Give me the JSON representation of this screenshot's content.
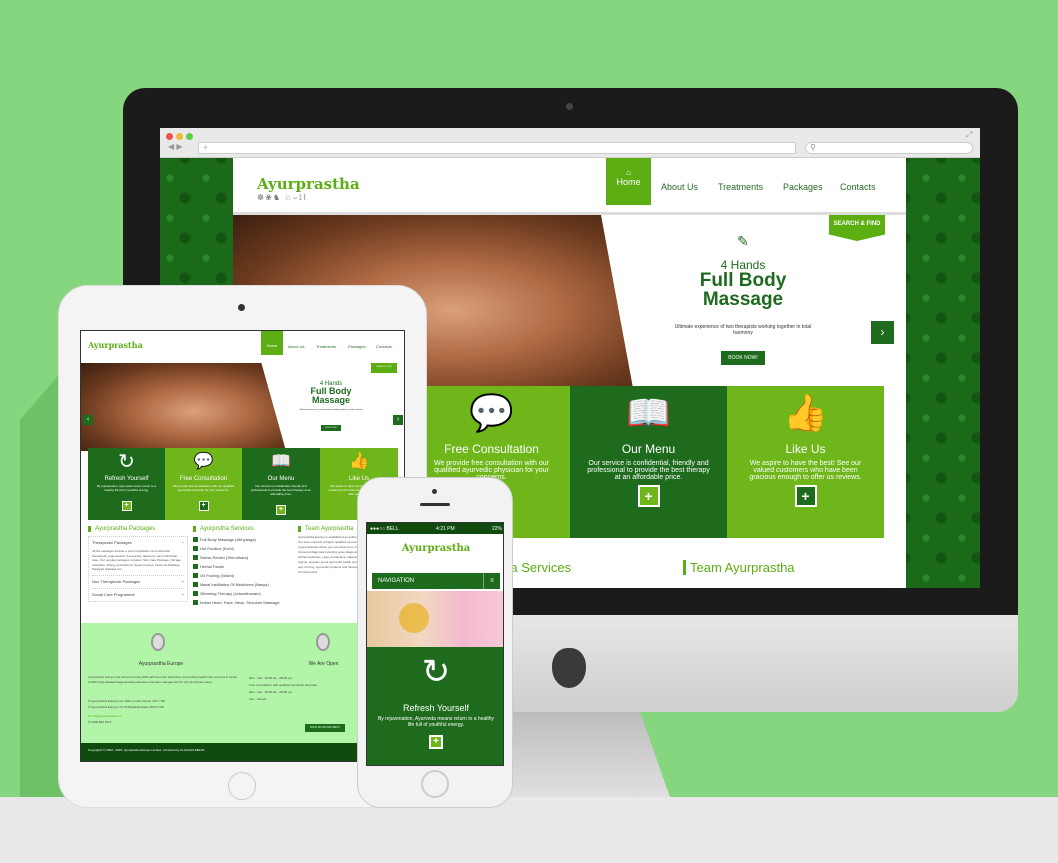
{
  "desktop": {
    "search_placeholder": "",
    "logo": "Ayurprastha",
    "logo_symbols": "☸❀♞ ♘⌣⟟⌇",
    "nav": [
      {
        "label": "Home",
        "icon": "home-icon"
      },
      {
        "label": "About Us"
      },
      {
        "label": "Treatments"
      },
      {
        "label": "Packages"
      },
      {
        "label": "Contacts"
      }
    ],
    "search_find": "SEARCH & FIND",
    "hero": {
      "subtitle": "4 Hands",
      "title1": "Full Body",
      "title2": "Massage",
      "desc": "Ultimate experience of two therapists working together in total harmony",
      "cta": "BOOK NOW!"
    },
    "features": [
      {
        "title": "Free Consultation",
        "text": "We provide free consultation with our qualified ayurvedic physician for your concerns.",
        "icon": "chat-bubbles-icon"
      },
      {
        "title": "Our Menu",
        "text": "Our service is confidential, friendly and professional to provide the best therapy at an affordable price.",
        "icon": "book-icon"
      },
      {
        "title": "Like Us",
        "text": "We aspire to have the best! See our valued customers who have been gracious enough to offer us reviews.",
        "icon": "thumbs-up-icon"
      }
    ],
    "headings": [
      "Ayurprstha Services",
      "Team Ayurprastha"
    ]
  },
  "tablet": {
    "logo": "Ayurprastha",
    "nav": [
      "Home",
      "About Us",
      "Treatments",
      "Packages",
      "Contacts"
    ],
    "search_find": "SEARCH & FIND",
    "hero": {
      "subtitle": "4 Hands",
      "title1": "Full Body",
      "title2": "Massage",
      "desc": "Ultimate experience of two therapists working together in total harmony",
      "cta": "BOOK NOW!"
    },
    "features": [
      {
        "title": "Refresh Yourself",
        "text": "By rejuvenation, Ayurveda means return to a healthy life full of youthful energy."
      },
      {
        "title": "Free Consultation",
        "text": "We provide free consultation with our qualified ayurvedic physician for your concerns."
      },
      {
        "title": "Our Menu",
        "text": "Our service is confidential, friendly and professional to provide the best therapy at an affordable price."
      },
      {
        "title": "Like Us",
        "text": "We aspire to have the best! See our valued customers who have been gracious enough to offer us reviews."
      }
    ],
    "packages": {
      "heading": "Ayurprastha Packages",
      "items": [
        {
          "label": "Therapeutic Packages",
          "toggle": "−",
          "text": "All the packages include a prior consultation and individual therapeutic yoga session if necessary tailored to each individual case. Our popular packages includes: Skin Care Package, Old age relaxation, Allergy and Asthma, Sports Injuries, Insomnia Package, Paralysis Package etc."
        },
        {
          "label": "Non Therapeutic Packages",
          "toggle": "+"
        },
        {
          "label": "Social Care Programme",
          "toggle": "+"
        }
      ]
    },
    "services": {
      "heading": "Ayurprstha Services",
      "items": [
        "Full Body Massage (Abhyanga)",
        "Hot Poultice (Kizhi)",
        "Stress Reviler (Shirodhara)",
        "Herbal Facial",
        "Oil Pooling (Vasthi)",
        "Nasal Instillation Of Medicines (Nasya)",
        "Slimming Therapy (Udwarthanam)",
        "Indian Head, Face, Neck, Shoulder Massage"
      ]
    },
    "team": {
      "heading": "Team Ayurprastha",
      "text": "Ayurprastha Europe is established as authentic ayurvedic health centres. Our team consists of highly qualified ayurvedic consultant doctors and yoga therapists whom you can depend on. A perfect blend of time honoured diagnosis including pulse diagnosis, conventional and effective herbal medicines, yoga, pranayama, balanced diet as per the ayurvedic regime, program at our ayurvedic health centre promote the most natural way of living, ayurvedic products and therapeutic methods for the existence of human kind."
    },
    "footer": {
      "about_title": "Ayurprastha Europe",
      "about_text": "Ayurprastha Europe has formed in early 2006 with the main objectives of providing health care services in sector of ARD (Age Related Degenerative) diseases and pain management for chronic illness cases.",
      "addresses": [
        "Ayurprastha Europe Ltd, 304m London Road, CR7 7HD",
        "Ayurprastha Europe Ltd, 80 Bradwell Road, MK13 7AD"
      ],
      "email": "info@ayurprastha.com",
      "phone": "0208 684 7574",
      "open_title": "We Are Open",
      "hours": [
        "Mon - Sat : 10:00 am - 08:00 pm",
        "Free consultation with qualified ayurvedic physician",
        "Mon - Sat : 10:00 am - 05:00 pm",
        "Sun : Closed"
      ],
      "button": "BOOK AN APPOINTMENT",
      "copyright": "Copyrights © 2006 - 2015, Ayurprastha Europe Limited - Powered by ALLIKKAS MEDIA"
    }
  },
  "phone": {
    "carrier": "●●●○○ BELL",
    "time": "4:21 PM",
    "battery": "22%",
    "logo": "Ayurprastha",
    "nav": "NAVIGATION",
    "feature": {
      "title": "Refresh Yourself",
      "text": "By rejuvenation, Ayurveda means return to a healthy life full of youthful energy."
    }
  },
  "colors": {
    "background": "#85d67e",
    "accent_light": "#6fb61b",
    "accent_dark": "#1e6b1e"
  }
}
